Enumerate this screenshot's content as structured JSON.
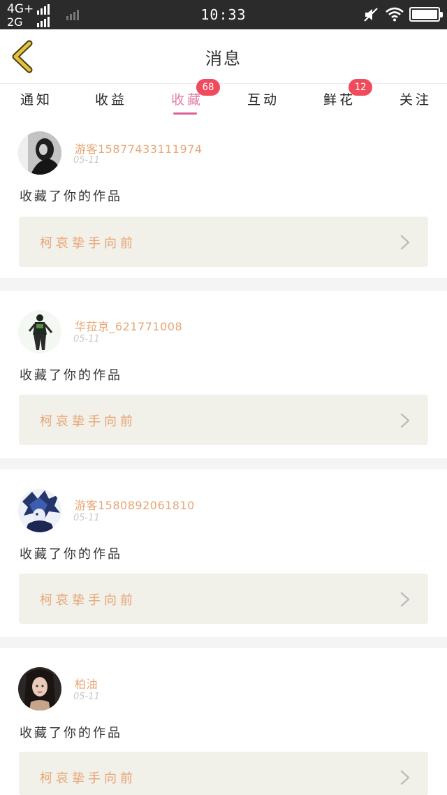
{
  "status_bar": {
    "network_top": "4G+",
    "network_bottom": "2G",
    "time": "10:33",
    "icons": [
      "signal-icon",
      "mute-icon",
      "wifi-icon",
      "battery-icon"
    ]
  },
  "header": {
    "title": "消息",
    "back_icon": "chevron-left-icon"
  },
  "tabs": {
    "active_index": 2,
    "items": [
      {
        "label": "通知"
      },
      {
        "label": "收益"
      },
      {
        "label": "收藏",
        "badge": "68"
      },
      {
        "label": "互动"
      },
      {
        "label": "鲜花",
        "badge": "12"
      },
      {
        "label": "关注"
      }
    ]
  },
  "feed": {
    "items": [
      {
        "username": "游客15877433111974",
        "date": "05-11",
        "action": "收藏了你的作品",
        "work_title": "柯哀挚手向前"
      },
      {
        "username": "华菈京_621771008",
        "date": "05-11",
        "action": "收藏了你的作品",
        "work_title": "柯哀挚手向前"
      },
      {
        "username": "游客15808920618​10",
        "date": "05-11",
        "action": "收藏了你的作品",
        "work_title": "柯哀挚手向前"
      },
      {
        "username": "柏油",
        "date": "05-11",
        "action": "收藏了你的作品",
        "work_title": "柯哀挚手向前"
      }
    ]
  },
  "colors": {
    "accent_pink": "#e05f98",
    "badge_red": "#f04a5d",
    "username_orange": "#e8a574",
    "back_icon_yellow": "#e2c33e",
    "link_bg": "#f1f0e9"
  }
}
